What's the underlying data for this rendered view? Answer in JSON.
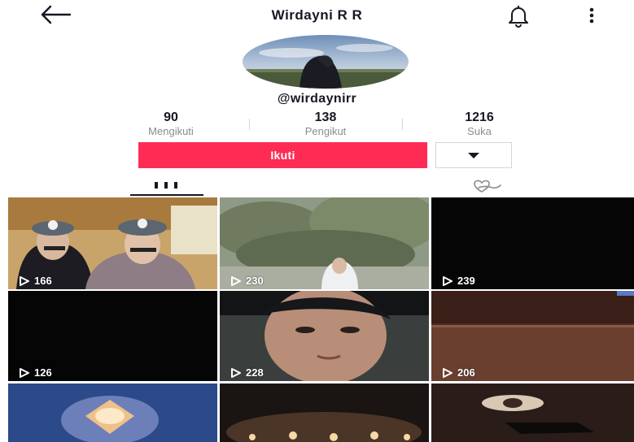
{
  "header": {
    "title": "Wirdayni R R"
  },
  "profile": {
    "handle": "@wirdaynirr",
    "stats": [
      {
        "value": "90",
        "label": "Mengikuti"
      },
      {
        "value": "138",
        "label": "Pengikut"
      },
      {
        "value": "1216",
        "label": "Suka"
      }
    ],
    "follow_label": "Ikuti"
  },
  "icons": {
    "back": "arrow-left-icon",
    "notifications": "bell-icon",
    "more": "more-vertical-icon",
    "dropdown": "caret-down-icon",
    "tab_videos": "grid-icon",
    "tab_liked": "heart-hand-icon",
    "views": "play-outline-icon"
  },
  "colors": {
    "accent": "#fe2c55",
    "text": "#161823",
    "muted": "#8a8b91"
  },
  "videos": [
    {
      "views": "166"
    },
    {
      "views": "230"
    },
    {
      "views": "239"
    },
    {
      "views": "126"
    },
    {
      "views": "228"
    },
    {
      "views": "206"
    },
    {
      "views": ""
    },
    {
      "views": ""
    },
    {
      "views": ""
    }
  ]
}
